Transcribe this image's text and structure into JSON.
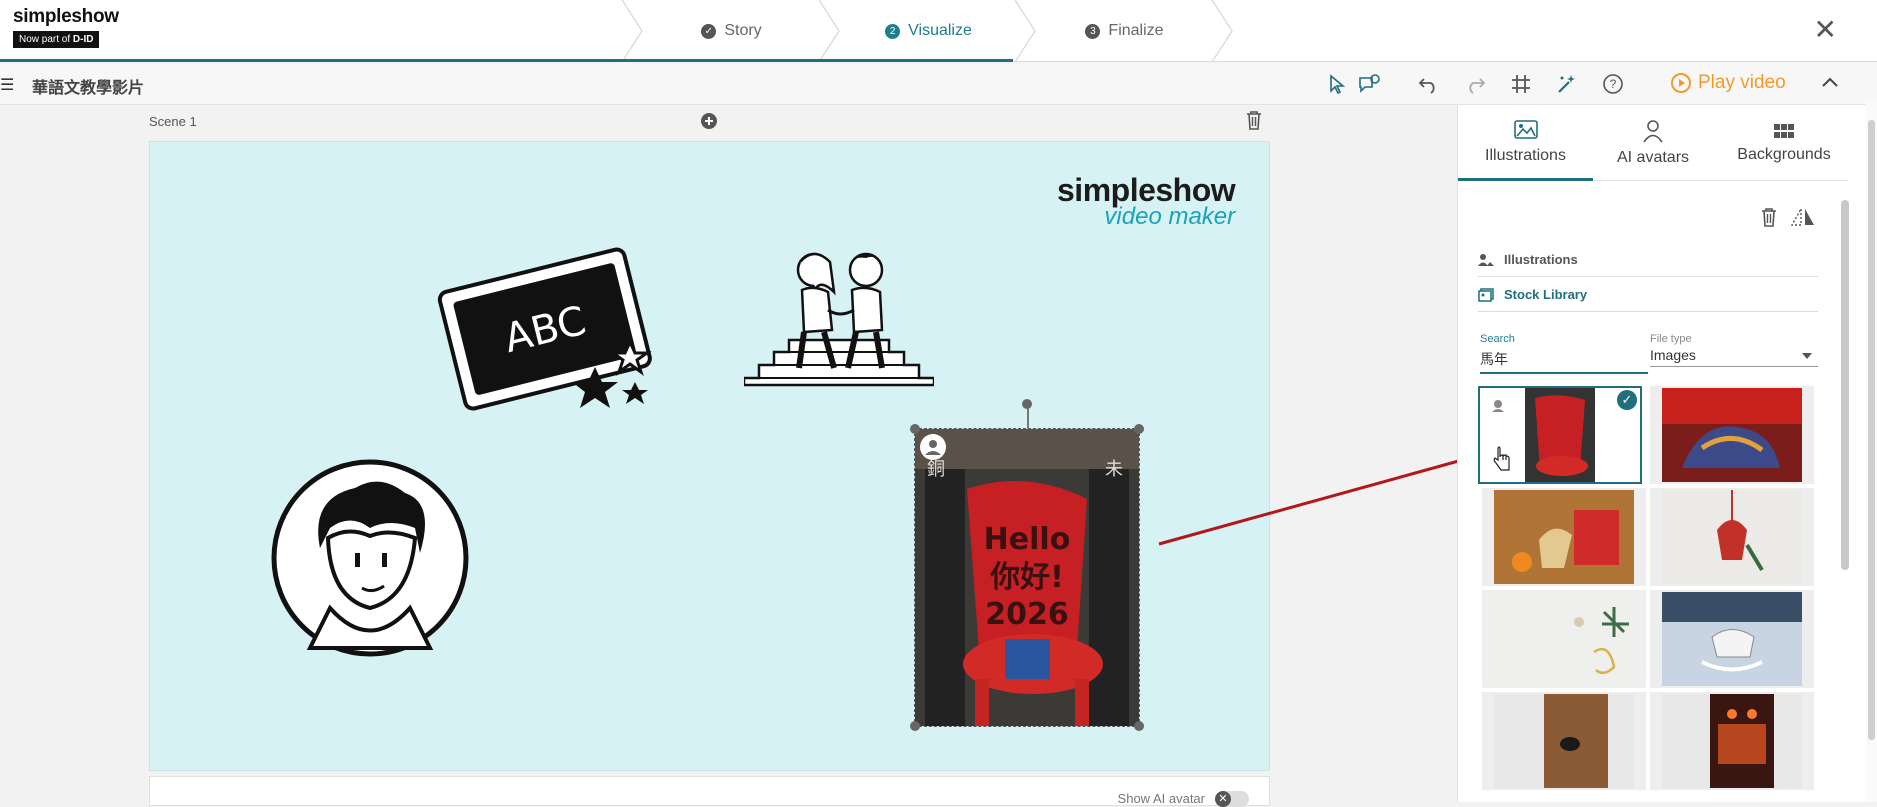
{
  "brand": {
    "name": "simpleshow",
    "tagline": "Now part of",
    "partner": "D-ID"
  },
  "steps": [
    {
      "label": "Story",
      "badge": "✓",
      "state": "done"
    },
    {
      "label": "Visualize",
      "badge": "2",
      "state": "active"
    },
    {
      "label": "Finalize",
      "badge": "3",
      "state": "todo"
    }
  ],
  "toolbar": {
    "project_title": "華語文教學影片",
    "play_label": "Play video"
  },
  "scene": {
    "label": "Scene 1",
    "show_ai_avatar": "Show AI avatar"
  },
  "stage_logo": {
    "main": "simpleshow",
    "sub": "video maker"
  },
  "chalkboard": {
    "text": "ABC"
  },
  "banner": {
    "line1": "Hello",
    "line2": "你好!",
    "line3": "2026",
    "side_left": "銅",
    "side_right": "未"
  },
  "panel": {
    "tabs": [
      "Illustrations",
      "AI avatars",
      "Backgrounds"
    ],
    "active_tab": "Illustrations",
    "source_illustrations": "Illustrations",
    "source_stock": "Stock Library",
    "search_label": "Search",
    "search_value": "馬年",
    "filetype_label": "File type",
    "filetype_value": "Images"
  },
  "colors": {
    "accent": "#1f6f7c",
    "play": "#f39a2b",
    "stage": "#d6f2f5"
  }
}
